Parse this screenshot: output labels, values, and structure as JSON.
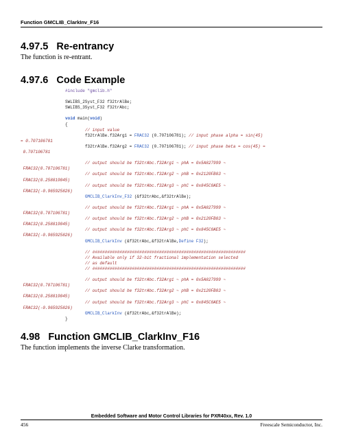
{
  "header": "Function GMCLIB_ClarkInv_F16",
  "section1": {
    "number": "4.97.5",
    "title": "Re-entrancy"
  },
  "section1_body": "The function is re-entrant.",
  "section2": {
    "number": "4.97.6",
    "title": "Code Example"
  },
  "section3": {
    "number": "4.98",
    "title": "Function GMCLIB_ClarkInv_F16"
  },
  "section3_body": "The function implements the inverse Clarke transformation.",
  "footer": {
    "title": "Embedded Software and Motor Control Libraries for PXR40xx, Rev. 1.0",
    "page": "456",
    "company": "Freescale Semiconductor, Inc."
  },
  "code": {
    "include": "#include \"gmclib.h\"",
    "decl1": "SWLIBS_2Syst_F32 f32trAlBe;",
    "decl2": "SWLIBS_3Syst_F32 f32trAbc;",
    "void": "void",
    "main": " main(",
    "void2": "void",
    "main_close": ")",
    "brace_open": "{",
    "c_input": "// input value",
    "l_arg1a": "f32trAlBe.f32Arg1 = ",
    "frac32": "FRAC32",
    "l_arg1b": " (0.707106781); ",
    "c_arg1": "// input phase alpha = sin(45)",
    "wrap1": "= 0.707106781",
    "l_arg2a": "f32trAlBe.f32Arg2 = ",
    "l_arg2b": " (0.707106781); ",
    "c_arg2": "// input phase beta = cos(45) =",
    "wrap2": " 0.707106781",
    "c_out1a": "// output should be f32trAbc.f32Arg1 ~ phA = 0x5A827999 ~",
    "wrap_out1": " FRAC32(0.707106781)",
    "c_out2a": "// output should be f32trAbc.f32Arg2 ~ phB = 0x2120FB83 ~",
    "wrap_out2": " FRAC32(0.258819045)",
    "c_out3a": "// output should be f32trAbc.f32Arg3 ~ phC = 0x845C8AE5 ~",
    "wrap_out3": " FRAC32(-0.965925826)",
    "call1": "GMCLIB_ClarkInv_F32",
    "call1_args": " (&f32trAbc,&f32trAlBe);",
    "call2": "GMCLIB_ClarkInv",
    "call2_args": " (&f32trAbc,&f32trAlBe,",
    "define_f32": "Define F32",
    "call2_close": ");",
    "c_hash1": "// ##############################################################",
    "c_avail": "// Available only if 32-bit fractional implementation selected",
    "c_default": "// as default",
    "c_hash2": "// ##############################################################",
    "call3": "GMCLIB_ClarkInv",
    "call3_args": " (&f32trAbc,&f32trAlBe);",
    "brace_close": "}"
  }
}
